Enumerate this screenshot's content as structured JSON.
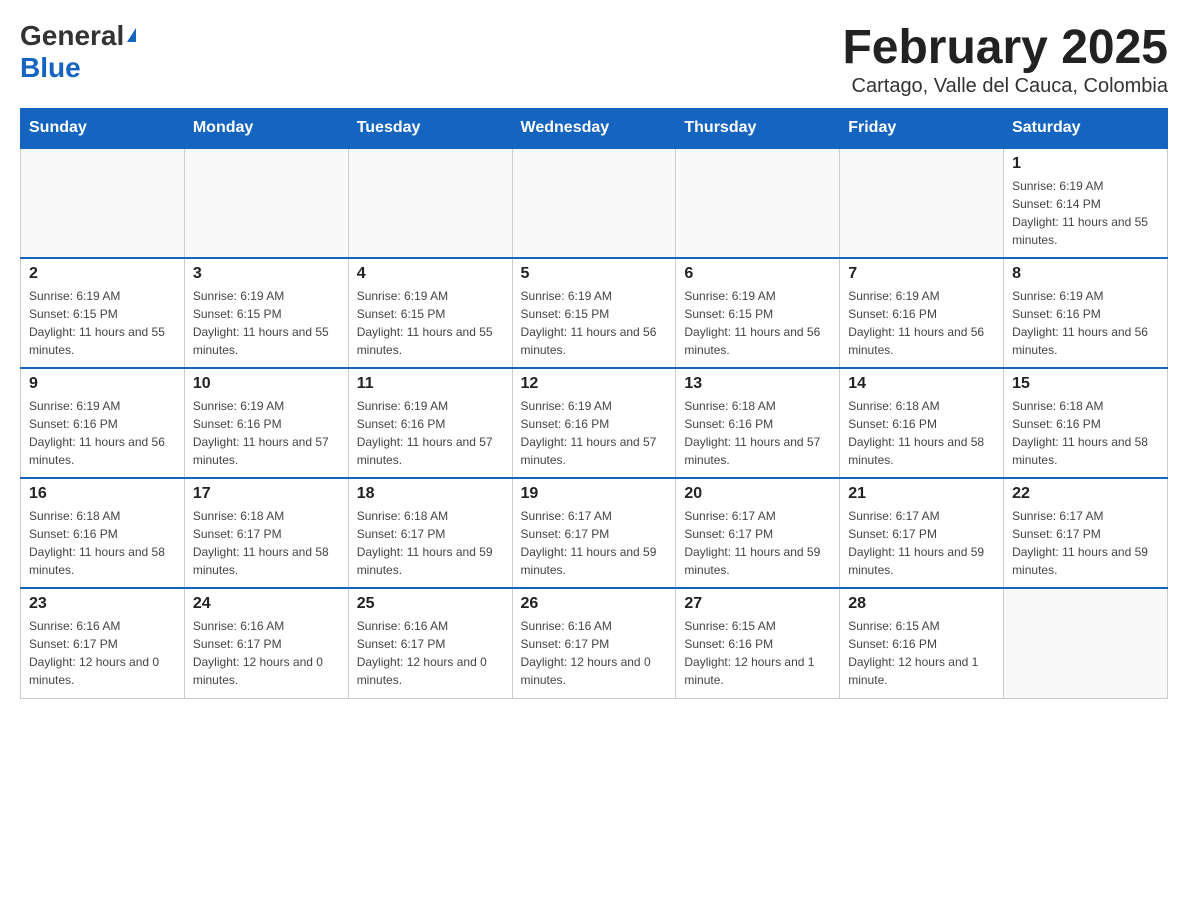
{
  "header": {
    "logo_general": "General",
    "logo_blue": "Blue",
    "month_year": "February 2025",
    "location": "Cartago, Valle del Cauca, Colombia"
  },
  "days_of_week": [
    "Sunday",
    "Monday",
    "Tuesday",
    "Wednesday",
    "Thursday",
    "Friday",
    "Saturday"
  ],
  "weeks": [
    [
      {
        "day": "",
        "info": ""
      },
      {
        "day": "",
        "info": ""
      },
      {
        "day": "",
        "info": ""
      },
      {
        "day": "",
        "info": ""
      },
      {
        "day": "",
        "info": ""
      },
      {
        "day": "",
        "info": ""
      },
      {
        "day": "1",
        "info": "Sunrise: 6:19 AM\nSunset: 6:14 PM\nDaylight: 11 hours and 55 minutes."
      }
    ],
    [
      {
        "day": "2",
        "info": "Sunrise: 6:19 AM\nSunset: 6:15 PM\nDaylight: 11 hours and 55 minutes."
      },
      {
        "day": "3",
        "info": "Sunrise: 6:19 AM\nSunset: 6:15 PM\nDaylight: 11 hours and 55 minutes."
      },
      {
        "day": "4",
        "info": "Sunrise: 6:19 AM\nSunset: 6:15 PM\nDaylight: 11 hours and 55 minutes."
      },
      {
        "day": "5",
        "info": "Sunrise: 6:19 AM\nSunset: 6:15 PM\nDaylight: 11 hours and 56 minutes."
      },
      {
        "day": "6",
        "info": "Sunrise: 6:19 AM\nSunset: 6:15 PM\nDaylight: 11 hours and 56 minutes."
      },
      {
        "day": "7",
        "info": "Sunrise: 6:19 AM\nSunset: 6:16 PM\nDaylight: 11 hours and 56 minutes."
      },
      {
        "day": "8",
        "info": "Sunrise: 6:19 AM\nSunset: 6:16 PM\nDaylight: 11 hours and 56 minutes."
      }
    ],
    [
      {
        "day": "9",
        "info": "Sunrise: 6:19 AM\nSunset: 6:16 PM\nDaylight: 11 hours and 56 minutes."
      },
      {
        "day": "10",
        "info": "Sunrise: 6:19 AM\nSunset: 6:16 PM\nDaylight: 11 hours and 57 minutes."
      },
      {
        "day": "11",
        "info": "Sunrise: 6:19 AM\nSunset: 6:16 PM\nDaylight: 11 hours and 57 minutes."
      },
      {
        "day": "12",
        "info": "Sunrise: 6:19 AM\nSunset: 6:16 PM\nDaylight: 11 hours and 57 minutes."
      },
      {
        "day": "13",
        "info": "Sunrise: 6:18 AM\nSunset: 6:16 PM\nDaylight: 11 hours and 57 minutes."
      },
      {
        "day": "14",
        "info": "Sunrise: 6:18 AM\nSunset: 6:16 PM\nDaylight: 11 hours and 58 minutes."
      },
      {
        "day": "15",
        "info": "Sunrise: 6:18 AM\nSunset: 6:16 PM\nDaylight: 11 hours and 58 minutes."
      }
    ],
    [
      {
        "day": "16",
        "info": "Sunrise: 6:18 AM\nSunset: 6:16 PM\nDaylight: 11 hours and 58 minutes."
      },
      {
        "day": "17",
        "info": "Sunrise: 6:18 AM\nSunset: 6:17 PM\nDaylight: 11 hours and 58 minutes."
      },
      {
        "day": "18",
        "info": "Sunrise: 6:18 AM\nSunset: 6:17 PM\nDaylight: 11 hours and 59 minutes."
      },
      {
        "day": "19",
        "info": "Sunrise: 6:17 AM\nSunset: 6:17 PM\nDaylight: 11 hours and 59 minutes."
      },
      {
        "day": "20",
        "info": "Sunrise: 6:17 AM\nSunset: 6:17 PM\nDaylight: 11 hours and 59 minutes."
      },
      {
        "day": "21",
        "info": "Sunrise: 6:17 AM\nSunset: 6:17 PM\nDaylight: 11 hours and 59 minutes."
      },
      {
        "day": "22",
        "info": "Sunrise: 6:17 AM\nSunset: 6:17 PM\nDaylight: 11 hours and 59 minutes."
      }
    ],
    [
      {
        "day": "23",
        "info": "Sunrise: 6:16 AM\nSunset: 6:17 PM\nDaylight: 12 hours and 0 minutes."
      },
      {
        "day": "24",
        "info": "Sunrise: 6:16 AM\nSunset: 6:17 PM\nDaylight: 12 hours and 0 minutes."
      },
      {
        "day": "25",
        "info": "Sunrise: 6:16 AM\nSunset: 6:17 PM\nDaylight: 12 hours and 0 minutes."
      },
      {
        "day": "26",
        "info": "Sunrise: 6:16 AM\nSunset: 6:17 PM\nDaylight: 12 hours and 0 minutes."
      },
      {
        "day": "27",
        "info": "Sunrise: 6:15 AM\nSunset: 6:16 PM\nDaylight: 12 hours and 1 minute."
      },
      {
        "day": "28",
        "info": "Sunrise: 6:15 AM\nSunset: 6:16 PM\nDaylight: 12 hours and 1 minute."
      },
      {
        "day": "",
        "info": ""
      }
    ]
  ]
}
